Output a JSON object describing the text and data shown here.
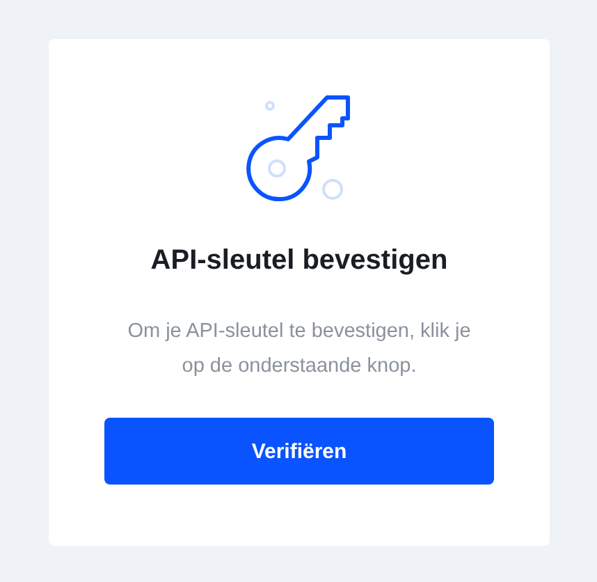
{
  "card": {
    "title": "API-sleutel bevestigen",
    "description": "Om je API-sleutel te bevestigen, klik je op de onderstaande knop.",
    "button": "Verifiëren"
  }
}
